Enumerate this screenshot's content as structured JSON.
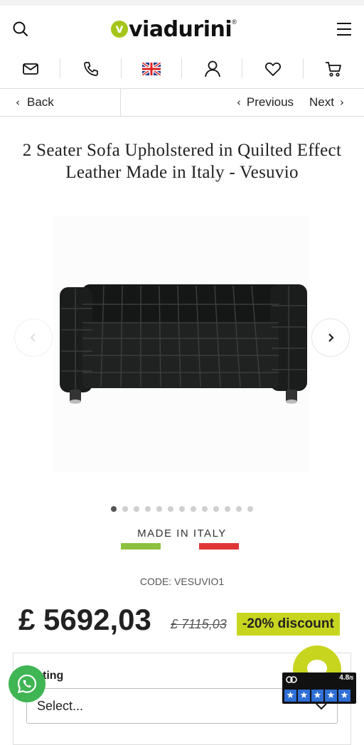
{
  "header": {
    "logo_mark": "v",
    "logo_text": "viadurini",
    "logo_reg": "®"
  },
  "icons": {
    "search": "search-icon",
    "menu": "hamburger-menu-icon",
    "iconbar": [
      "mail-icon",
      "phone-icon",
      "uk-flag-icon",
      "user-icon",
      "heart-icon",
      "cart-icon"
    ]
  },
  "nav": {
    "back_label": "Back",
    "previous_label": "Previous",
    "next_label": "Next"
  },
  "product": {
    "title": "2 Seater Sofa Upholstered in Quilted Effect Leather Made in Italy - Vesuvio",
    "made_in": "MADE IN ITALY",
    "code": "CODE: VESUVIO1",
    "price": "£ 5692,03",
    "old_price": "£ 7115,03",
    "discount": "-20% discount",
    "gallery_total": 13,
    "gallery_active": 1
  },
  "options": {
    "label": "Coating",
    "visible_label": "ting",
    "select_value": "Select..."
  },
  "rating": {
    "score": "4.8",
    "scale": "/5",
    "stars": 5
  },
  "colors": {
    "brand_green": "#a5c51a",
    "discount_bg": "#c7d51f",
    "italy_green": "#8cc13f",
    "italy_red": "#e03535",
    "whatsapp": "#3fb553",
    "star_blue": "#2f6fd6"
  }
}
